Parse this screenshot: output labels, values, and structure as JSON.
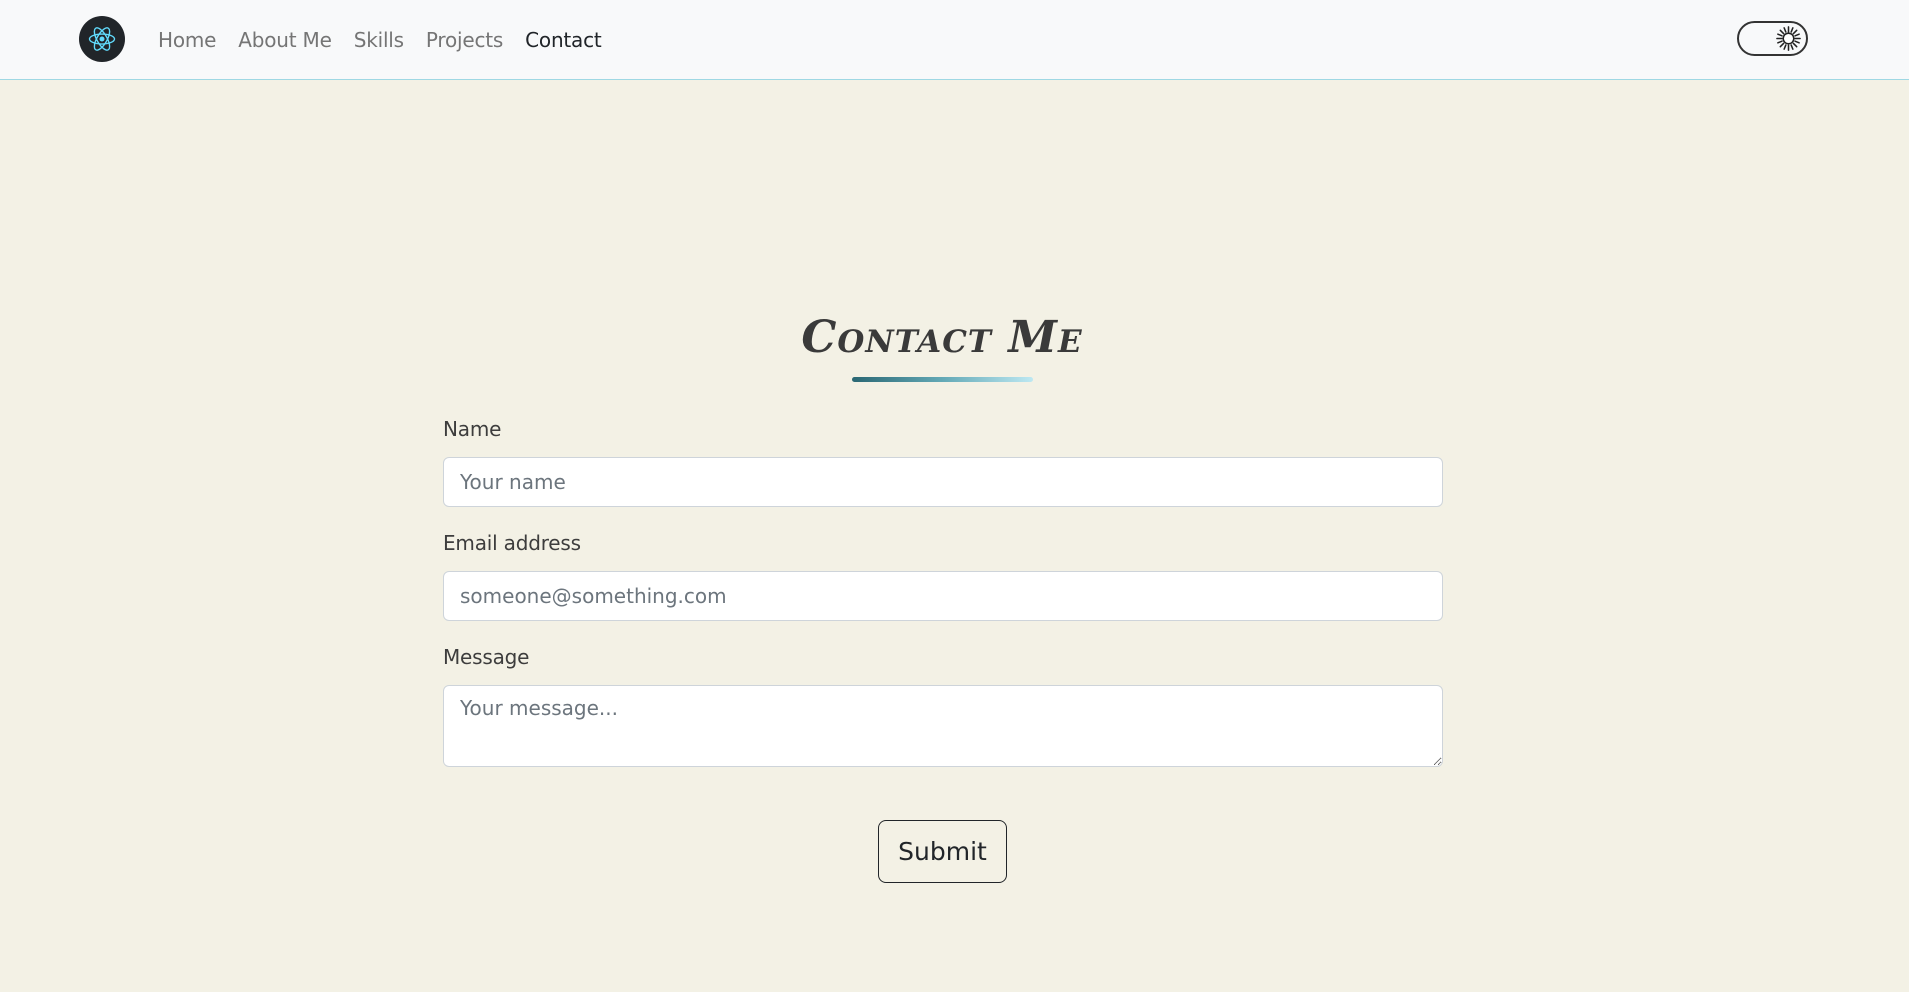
{
  "navbar": {
    "logo_icon": "react-atom-icon",
    "links": [
      {
        "label": "Home"
      },
      {
        "label": "About Me"
      },
      {
        "label": "Skills"
      },
      {
        "label": "Projects"
      },
      {
        "label": "Contact",
        "active": true
      }
    ],
    "theme_toggle_icon": "sun-icon"
  },
  "contact": {
    "title": "Contact Me",
    "fields": {
      "name": {
        "label": "Name",
        "placeholder": "Your name",
        "value": ""
      },
      "email": {
        "label": "Email address",
        "placeholder": "someone@something.com",
        "value": ""
      },
      "message": {
        "label": "Message",
        "placeholder": "Your message...",
        "value": ""
      }
    },
    "submit_label": "Submit"
  },
  "colors": {
    "page_bg": "#f3f1e5",
    "navbar_bg": "#f8f9fa",
    "navbar_border": "#9fd8e3",
    "logo_bg": "#212529",
    "react_blue": "#61dafb",
    "underline_gradient": [
      "#2a6773",
      "#bde8f2"
    ]
  }
}
